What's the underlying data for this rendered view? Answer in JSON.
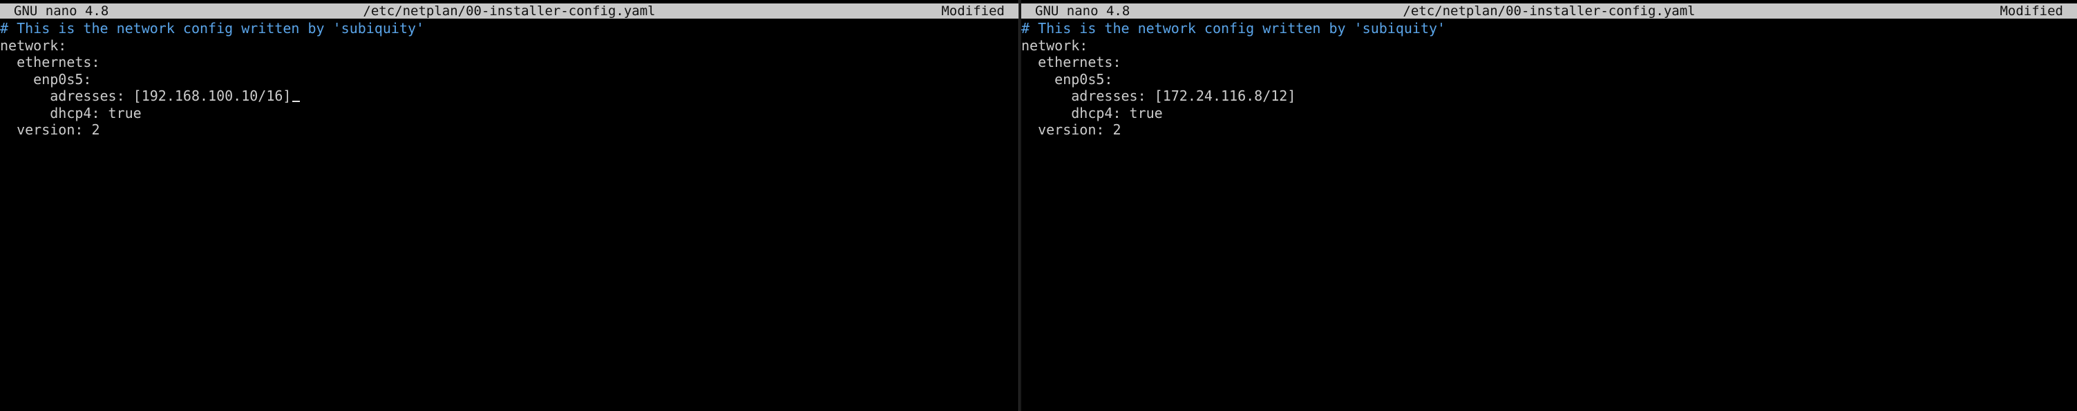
{
  "panes": [
    {
      "app_title": "GNU nano 4.8",
      "file_path": "/etc/netplan/00-installer-config.yaml",
      "status": "Modified",
      "lines": [
        "# This is the network config written by 'subiquity'",
        "network:",
        "  ethernets:",
        "    enp0s5:",
        "      adresses: [192.168.100.10/16]",
        "      dhcp4: true",
        "  version: 2"
      ]
    },
    {
      "app_title": "GNU nano 4.8",
      "file_path": "/etc/netplan/00-installer-config.yaml",
      "status": "Modified",
      "lines": [
        "# This is the network config written by 'subiquity'",
        "network:",
        "  ethernets:",
        "    enp0s5:",
        "      adresses: [172.24.116.8/12]",
        "      dhcp4: true",
        "  version: 2"
      ]
    }
  ],
  "colors": {
    "background": "#000000",
    "title_bar": "#c8c8c8",
    "comment": "#5aa4e8",
    "text": "#cccccc"
  }
}
